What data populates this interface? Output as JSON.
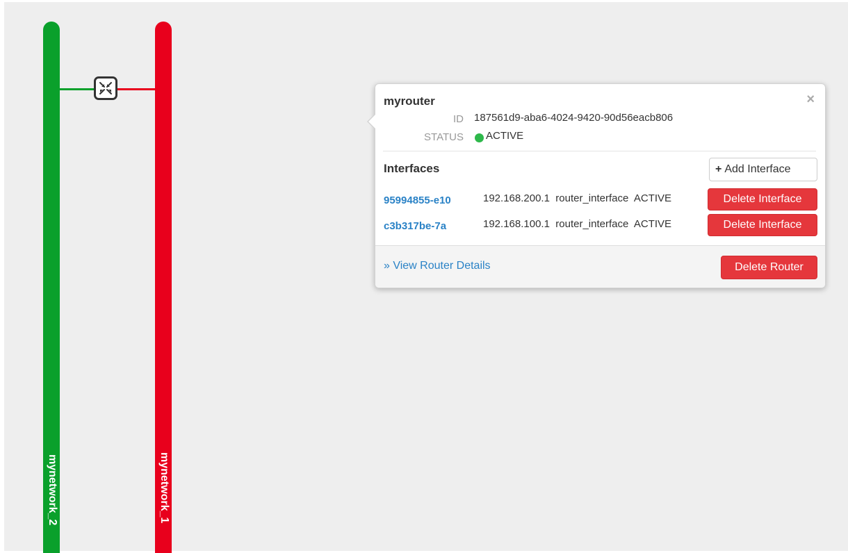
{
  "topology": {
    "networks": [
      {
        "name": "mynetwork_2",
        "color": "#0aa02b"
      },
      {
        "name": "mynetwork_1",
        "color": "#e8001c"
      }
    ],
    "router_icon": "router-arrows-icon"
  },
  "popover": {
    "router_name": "myrouter",
    "id_label": "ID",
    "id_value": "187561d9-aba6-4024-9420-90d56eacb806",
    "status_label": "STATUS",
    "status_value": "ACTIVE",
    "status_color": "#2eb84b",
    "close_glyph": "×",
    "interfaces_title": "Interfaces",
    "add_interface_icon": "+",
    "add_interface_label": "Add Interface",
    "interfaces": [
      {
        "id": "95994855-e10",
        "ip": "192.168.200.1",
        "type": "router_interface",
        "status": "ACTIVE",
        "delete_label": "Delete Interface"
      },
      {
        "id": "c3b317be-7a",
        "ip": "192.168.100.1",
        "type": "router_interface",
        "status": "ACTIVE",
        "delete_label": "Delete Interface"
      }
    ],
    "view_details_label": "» View Router Details",
    "delete_router_label": "Delete Router",
    "danger_color": "#e5373c",
    "link_color": "#2a82c6"
  }
}
